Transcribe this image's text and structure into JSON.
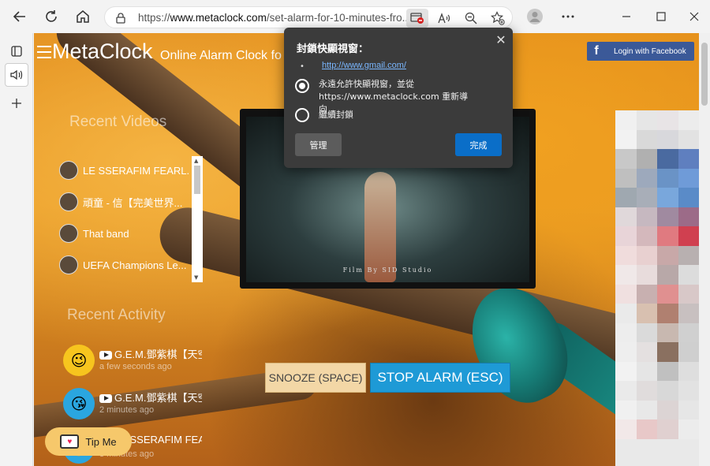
{
  "browser": {
    "url_prefix": "https://",
    "url_host": "www.metaclock.com",
    "url_path": "/set-alarm-for-10-minutes-fro...",
    "icons": [
      "back-icon",
      "refresh-icon",
      "home-icon",
      "lock-icon",
      "popup-blocked-icon",
      "read-aloud-icon",
      "zoom-out-icon",
      "favorite-add-icon",
      "profile-icon",
      "more-icon",
      "minimize-icon",
      "maximize-icon",
      "close-icon"
    ]
  },
  "edge_sidebar": {
    "icons": [
      "tab-actions-icon",
      "speaker-icon",
      "add-icon"
    ]
  },
  "site": {
    "logo": "MetaClock",
    "tagline": "Online Alarm Clock fo",
    "fb_login": "Login with Facebook",
    "recent_videos_title": "Recent Videos",
    "recent_videos": [
      {
        "title": "LE SSERAFIM FEARL..."
      },
      {
        "title": "頑童 - 信【完美世界..."
      },
      {
        "title": "That band"
      },
      {
        "title": "UEFA Champions Le..."
      }
    ],
    "recent_activity_title": "Recent Activity",
    "activity": [
      {
        "title": "G.E.M.鄧紫棋【天空",
        "time": "a few seconds ago",
        "emoji": "😉",
        "color": "#f7c51e"
      },
      {
        "title": "G.E.M.鄧紫棋【天空",
        "time": "2 minutes ago",
        "emoji": "😘",
        "color": "#2aa6e0"
      },
      {
        "title": "LE SSERAFIM FEAR",
        "time": "3 minutes ago",
        "emoji": "🙂",
        "color": "#2aa6e0"
      }
    ],
    "tip_label": "Tip Me",
    "video_caption": "Film By SID Studio",
    "snooze_label": "SNOOZE (SPACE)",
    "stop_label": "STOP ALARM (ESC)"
  },
  "popup_dialog": {
    "title": "封鎖快顯視窗：",
    "blocked_link": "http://www.gmail.com/",
    "option_allow": "永遠允許快顯視窗，並從 https://www.metaclock.com 重新導向",
    "option_block": "繼續封鎖",
    "manage_label": "管理",
    "done_label": "完成"
  },
  "ad_colors": [
    "#f0f0f0",
    "#e6e6e6",
    "#e8e4e6",
    "#ececec",
    "#f2f2f2",
    "#d9d9d9",
    "#d8d8dc",
    "#e2e2e2",
    "#c8c8c8",
    "#b0b0b0",
    "#4a6aa0",
    "#5f7fbf",
    "#bfbfbf",
    "#9da9bc",
    "#6a93c6",
    "#6f9bd8",
    "#9fa8b0",
    "#a8aeb8",
    "#79a7dc",
    "#5a8bc8",
    "#e0d8da",
    "#c6b8c0",
    "#a08aa0",
    "#9c6b88",
    "#e8d4d8",
    "#d4b8bc",
    "#e07a80",
    "#d04050",
    "#f0dcdc",
    "#e8d0d0",
    "#c8a8a8",
    "#b8b0b0",
    "#f0e8e8",
    "#e8dcdc",
    "#b8a8a8",
    "#dcdcdc",
    "#f0e0e0",
    "#c8b0b0",
    "#e09090",
    "#d8c8c8",
    "#eaeaea",
    "#d8c0b0",
    "#b08070",
    "#c8c0c0",
    "#ededed",
    "#dadada",
    "#c8b8b0",
    "#d0d0d0",
    "#eeeeee",
    "#e4e0e0",
    "#8a7060",
    "#cfcfcf",
    "#f2f2f2",
    "#e5e5e5",
    "#c0c0c0",
    "#dedede",
    "#eaeaea",
    "#e0dcdc",
    "#d8d8d8",
    "#e2e2e2",
    "#f0f0f0",
    "#e8e8e8",
    "#dcd4d4",
    "#e6e6e6",
    "#f2e8e8",
    "#e8c8c8",
    "#e0d0d0",
    "#ececec"
  ]
}
